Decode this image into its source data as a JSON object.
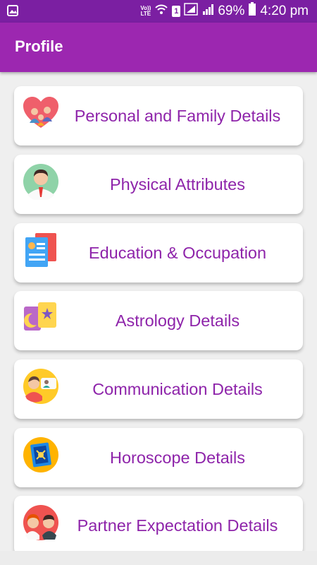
{
  "status_bar": {
    "lte_line1": "Vo))",
    "lte_line2": "LTE",
    "sim_number": "1",
    "battery": "69%",
    "time": "4:20 pm"
  },
  "app_bar": {
    "title": "Profile"
  },
  "menu": [
    {
      "label": "Personal and Family Details",
      "icon": "heart-family-icon"
    },
    {
      "label": "Physical Attributes",
      "icon": "man-avatar-icon"
    },
    {
      "label": "Education & Occupation",
      "icon": "documents-icon"
    },
    {
      "label": "Astrology Details",
      "icon": "moon-star-cards-icon"
    },
    {
      "label": "Communication Details",
      "icon": "chat-people-icon"
    },
    {
      "label": "Horoscope Details",
      "icon": "horoscope-chart-icon"
    },
    {
      "label": "Partner Expectation Details",
      "icon": "couple-icon"
    }
  ],
  "colors": {
    "status_bar": "#7b1fa2",
    "app_bar": "#9c27b0",
    "label": "#8e24aa"
  }
}
